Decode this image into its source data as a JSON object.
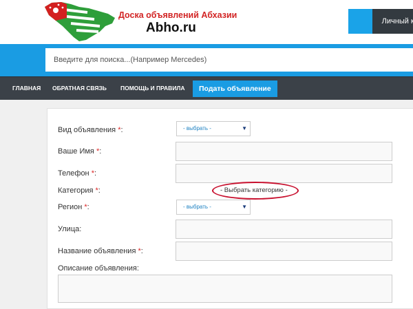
{
  "header": {
    "site_title": "Доска объявлений Абхазии",
    "site_domain": "Abho.ru",
    "cabinet_label": "Личный к"
  },
  "search": {
    "placeholder": "Введите для поиска...(Например Mercedes)"
  },
  "nav": {
    "items": [
      "ГЛАВНАЯ",
      "ОБРАТНАЯ СВЯЗЬ",
      "ПОМОЩЬ И ПРАВИЛА"
    ],
    "cta": "Подать объявление"
  },
  "form": {
    "type_label": "Вид объявления",
    "name_label": "Ваше Имя",
    "phone_label": "Телефон",
    "category_label": "Категория",
    "region_label": "Регион",
    "street_label": "Улица:",
    "title_label": "Название объявления",
    "description_label": "Описание объявления:",
    "required_mark": "*",
    "colon": ":",
    "select_placeholder": "- выбрать -",
    "category_link": "- Выбрать категорию -"
  },
  "colors": {
    "accent": "#1a9ce3",
    "nav_bg": "#3b4148",
    "required": "#dd2222",
    "highlight": "#c8102e"
  }
}
